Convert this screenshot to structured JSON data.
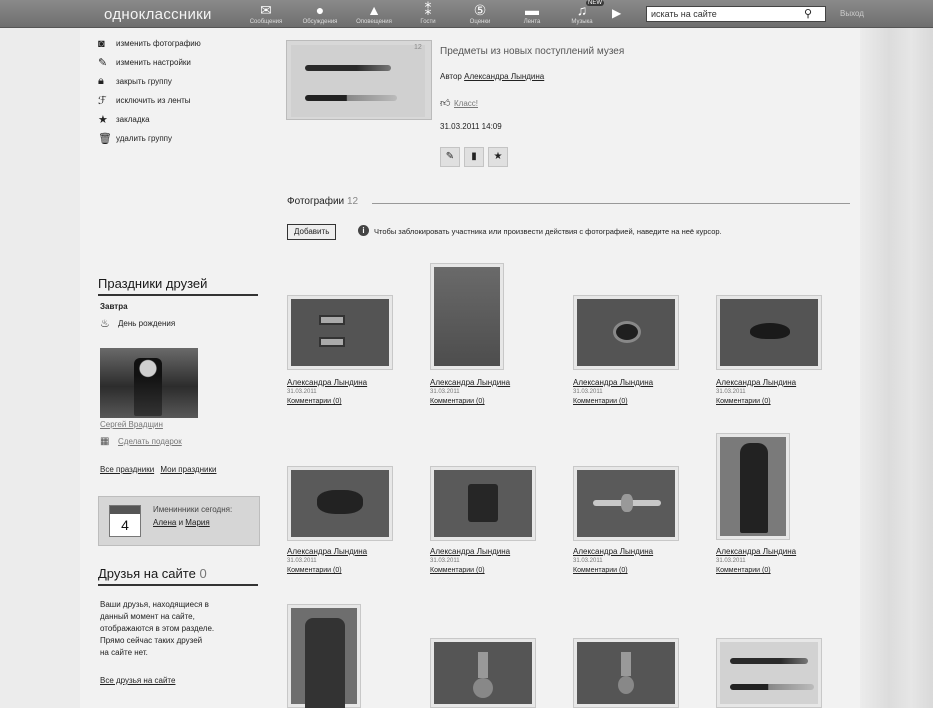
{
  "topbar": {
    "logo": "одноклассники",
    "nav": [
      {
        "label": "Сообщения",
        "icon": "envelope-icon"
      },
      {
        "label": "Обсуждения",
        "icon": "chat-bubbles-icon"
      },
      {
        "label": "Оповещения",
        "icon": "bell-icon"
      },
      {
        "label": "Гости",
        "icon": "footprints-icon"
      },
      {
        "label": "Оценки",
        "icon": "coin-5-icon"
      },
      {
        "label": "Лента",
        "icon": "feed-icon"
      },
      {
        "label": "Музыка",
        "icon": "music-note-icon"
      }
    ],
    "music_badge": "NEW",
    "search_value": "искать на сайте",
    "exit_label": "Выход"
  },
  "sidebar": {
    "actions": [
      {
        "label": "изменить фотографию",
        "icon": "camera-icon"
      },
      {
        "label": "изменить настройки",
        "icon": "pencil-icon"
      },
      {
        "label": "закрыть группу",
        "icon": "lock-icon"
      },
      {
        "label": "исключить из ленты",
        "icon": "exclude-icon"
      },
      {
        "label": "закладка",
        "icon": "star-icon"
      },
      {
        "label": "удалить группу",
        "icon": "trash-icon"
      }
    ],
    "holidays": {
      "title": "Праздники друзей",
      "when": "Завтра",
      "event": "День рождения",
      "friend_name": "Сергей Врадщин",
      "gift_link": "Сделать подарок",
      "all_link": "Все праздники",
      "my_link": "Мои праздники"
    },
    "namedays": {
      "label": "Именинники сегодня:",
      "day": "4",
      "name1": "Алена",
      "and": "и",
      "name2": "Мария"
    },
    "friends_online": {
      "title": "Друзья на сайте",
      "count": "0",
      "text": [
        "Ваши друзья, находящиеся в",
        "данный момент на сайте,",
        "отображаются в этом разделе.",
        "Прямо сейчас таких друзей",
        "на сайте нет."
      ],
      "link": "Все друзья на сайте"
    }
  },
  "album": {
    "title": "Предметы из новых поступлений музея",
    "author_prefix": "Автор",
    "author": "Александра Лындина",
    "like_label": "Класс!",
    "datetime": "31.03.2011 14:09",
    "thumb_count": "12"
  },
  "photos_section": {
    "title": "Фотографии",
    "count": "12",
    "add_button": "Добавить",
    "hint": "Чтобы заблокировать участника или произвести действия с фотографией, наведите на неё курсор."
  },
  "photos": [
    {
      "author": "Александра Лындина",
      "date": "31.03.2011",
      "comments": "Комментарии (0)"
    },
    {
      "author": "Александра Лындина",
      "date": "31.03.2011",
      "comments": "Комментарии (0)"
    },
    {
      "author": "Александра Лындина",
      "date": "31.03.2011",
      "comments": "Комментарии (0)"
    },
    {
      "author": "Александра Лындина",
      "date": "31.03.2011",
      "comments": "Комментарии (0)"
    },
    {
      "author": "Александра Лындина",
      "date": "31.03.2011",
      "comments": "Комментарии (0)"
    },
    {
      "author": "Александра Лындина",
      "date": "31.03.2011",
      "comments": "Комментарии (0)"
    },
    {
      "author": "Александра Лындина",
      "date": "31.03.2011",
      "comments": "Комментарии (0)"
    },
    {
      "author": "Александра Лындина",
      "date": "31.03.2011",
      "comments": "Комментарии (0)"
    }
  ]
}
